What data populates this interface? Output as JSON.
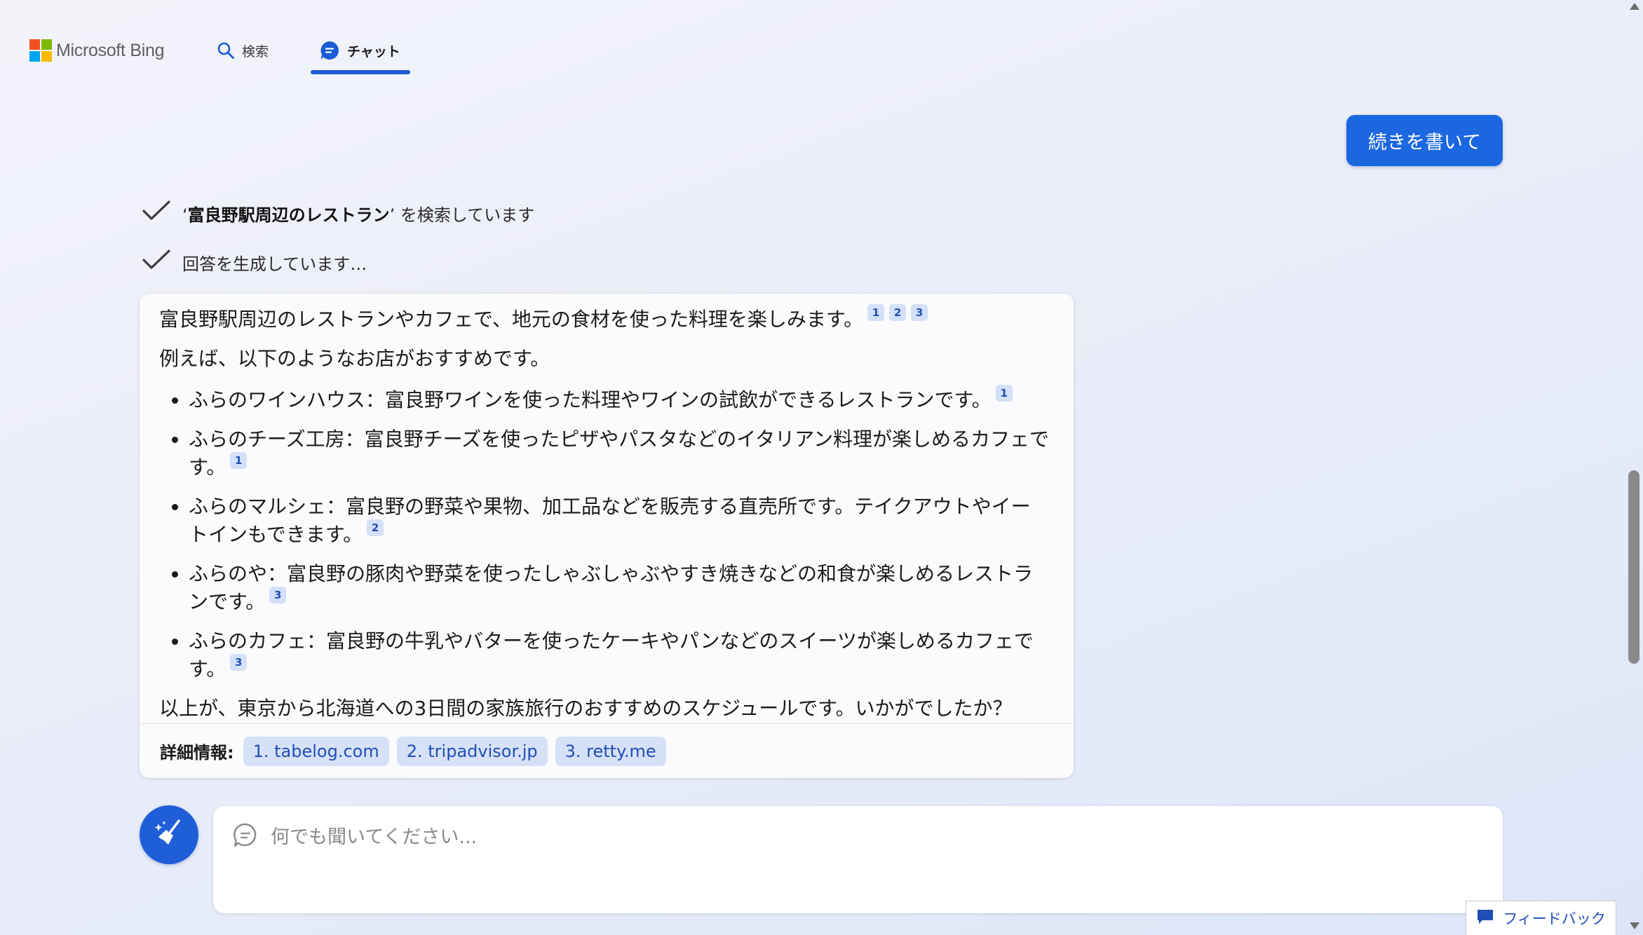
{
  "header": {
    "brand": "Microsoft Bing",
    "tabs": [
      {
        "label": "検索",
        "icon": "search-icon"
      },
      {
        "label": "チャット",
        "icon": "chat-icon",
        "active": true
      }
    ]
  },
  "continue_button": {
    "label": "続きを書いて"
  },
  "status": {
    "searching_query": "富良野駅周辺のレストラン",
    "searching_suffix": "を検索しています",
    "generating": "回答を生成しています…"
  },
  "answer": {
    "intro": "富良野駅周辺のレストランやカフェで、地元の食材を使った料理を楽しみます。",
    "intro_citations": [
      "1",
      "2",
      "3"
    ],
    "lead": "例えば、以下のようなお店がおすすめです。",
    "items": [
      {
        "text": "ふらのワインハウス：富良野ワインを使った料理やワインの試飲ができるレストランです。",
        "citation": "1"
      },
      {
        "text": "ふらのチーズ工房：富良野チーズを使ったピザやパスタなどのイタリアン料理が楽しめるカフェです。",
        "citation": "1"
      },
      {
        "text": "ふらのマルシェ：富良野の野菜や果物、加工品などを販売する直売所です。テイクアウトやイートインもできます。",
        "citation": "2"
      },
      {
        "text": "ふらのや：富良野の豚肉や野菜を使ったしゃぶしゃぶやすき焼きなどの和食が楽しめるレストランです。",
        "citation": "3"
      },
      {
        "text": "ふらのカフェ：富良野の牛乳やバターを使ったケーキやパンなどのスイーツが楽しめるカフェです。",
        "citation": "3"
      }
    ],
    "closing": "以上が、東京から北海道への3日間の家族旅行のおすすめのスケジュールです。いかがでしたか？",
    "sources_label": "詳細情報:",
    "sources": [
      "1. tabelog.com",
      "2. tripadvisor.jp",
      "3. retty.me"
    ]
  },
  "composer": {
    "placeholder": "何でも聞いてください...",
    "new_topic_icon": "broom-icon"
  },
  "feedback": {
    "label": "フィードバック",
    "icon": "feedback-icon"
  },
  "colors": {
    "accent": "#1a67e0",
    "citation_bg": "#d4e0f9",
    "citation_text": "#1f4fb5"
  }
}
